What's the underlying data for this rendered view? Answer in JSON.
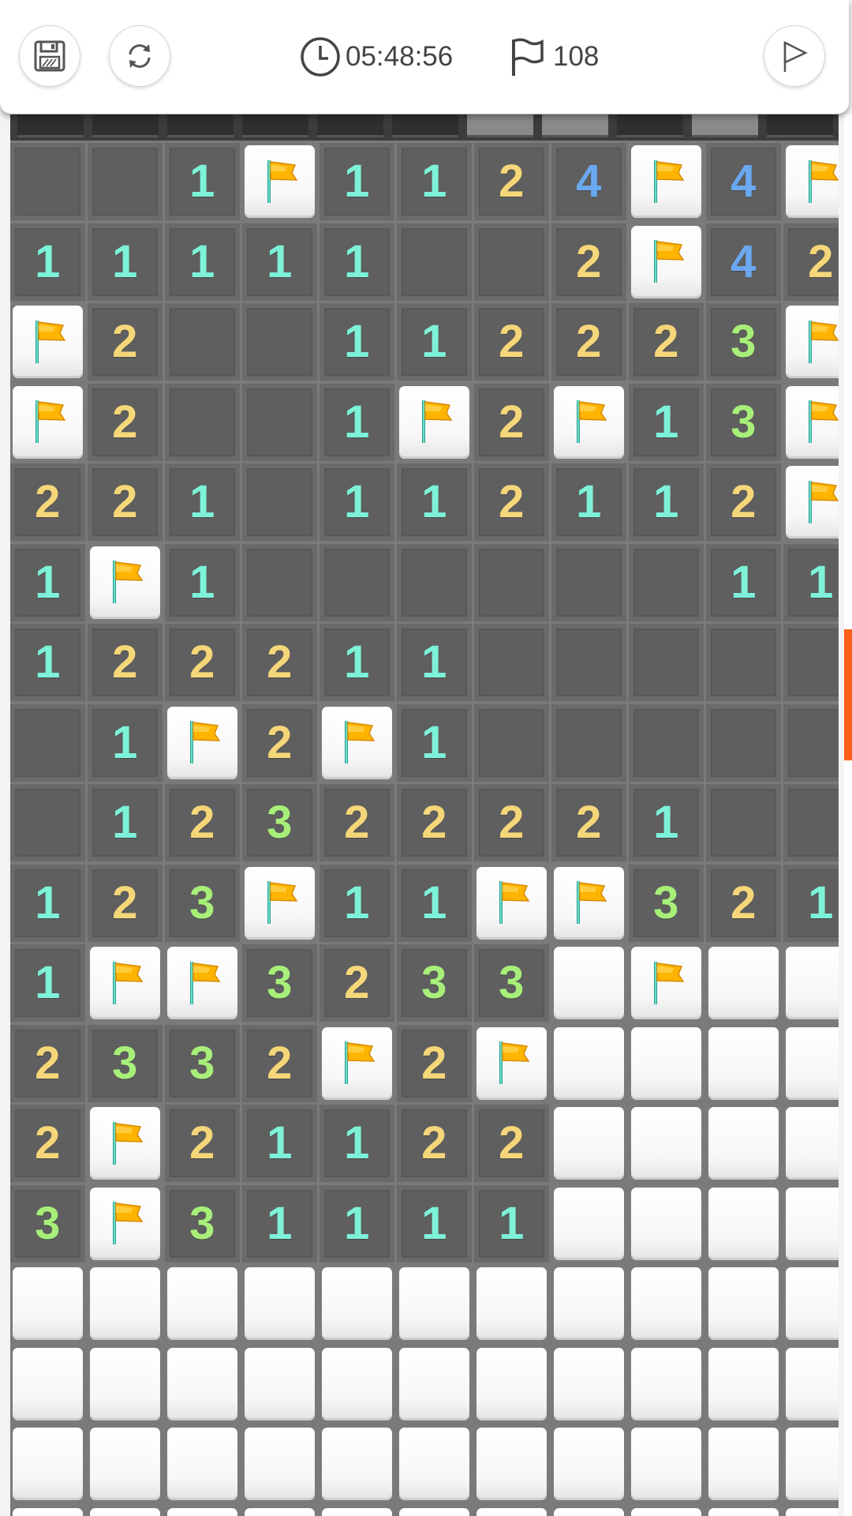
{
  "toolbar": {
    "timer": "05:48:56",
    "flags_left": "108",
    "save_icon": "save-icon",
    "restart_icon": "restart-icon",
    "clock_icon": "clock-icon",
    "flag_counter_icon": "flag-outline-icon",
    "flag_mode_icon": "flag-mode-icon"
  },
  "colors": {
    "n1": "#7df2d8",
    "n2": "#f5d77a",
    "n3": "#a8ef7a",
    "n4": "#6aa8f0",
    "flag": "#ffb400",
    "revealed": "#5f5f5f",
    "accent": "#ff5e1a"
  },
  "board": {
    "columns": 11,
    "rows": [
      [
        "E",
        "E",
        "1",
        "F",
        "1",
        "1",
        "2",
        "4",
        "F",
        "4",
        "F"
      ],
      [
        "1",
        "1",
        "1",
        "1",
        "1",
        "E",
        "E",
        "2",
        "F",
        "4",
        "2"
      ],
      [
        "F",
        "2",
        "E",
        "E",
        "1",
        "1",
        "2",
        "2",
        "2",
        "3",
        "F"
      ],
      [
        "F",
        "2",
        "E",
        "E",
        "1",
        "F",
        "2",
        "F",
        "1",
        "3",
        "F"
      ],
      [
        "2",
        "2",
        "1",
        "E",
        "1",
        "1",
        "2",
        "1",
        "1",
        "2",
        "F"
      ],
      [
        "1",
        "F",
        "1",
        "E",
        "E",
        "E",
        "E",
        "E",
        "E",
        "1",
        "1"
      ],
      [
        "1",
        "2",
        "2",
        "2",
        "1",
        "1",
        "E",
        "E",
        "E",
        "E",
        "E"
      ],
      [
        "E",
        "1",
        "F",
        "2",
        "F",
        "1",
        "E",
        "E",
        "E",
        "E",
        "E"
      ],
      [
        "E",
        "1",
        "2",
        "3",
        "2",
        "2",
        "2",
        "2",
        "1",
        "E",
        "E"
      ],
      [
        "1",
        "2",
        "3",
        "F",
        "1",
        "1",
        "F",
        "F",
        "3",
        "2",
        "1"
      ],
      [
        "1",
        "F",
        "F",
        "3",
        "2",
        "3",
        "3",
        "H",
        "F",
        "H",
        "H"
      ],
      [
        "2",
        "3",
        "3",
        "2",
        "F",
        "2",
        "F",
        "H",
        "H",
        "H",
        "H"
      ],
      [
        "2",
        "F",
        "2",
        "1",
        "1",
        "2",
        "2",
        "H",
        "H",
        "H",
        "H"
      ],
      [
        "3",
        "F",
        "3",
        "1",
        "1",
        "1",
        "1",
        "H",
        "H",
        "H",
        "H"
      ],
      [
        "H",
        "H",
        "H",
        "H",
        "H",
        "H",
        "H",
        "H",
        "H",
        "H",
        "H"
      ],
      [
        "H",
        "H",
        "H",
        "H",
        "H",
        "H",
        "H",
        "H",
        "H",
        "H",
        "H"
      ],
      [
        "H",
        "H",
        "H",
        "H",
        "H",
        "H",
        "H",
        "H",
        "H",
        "H",
        "H"
      ],
      [
        "H",
        "H",
        "H",
        "H",
        "H",
        "H",
        "H",
        "H",
        "H",
        "H",
        "H"
      ]
    ]
  }
}
